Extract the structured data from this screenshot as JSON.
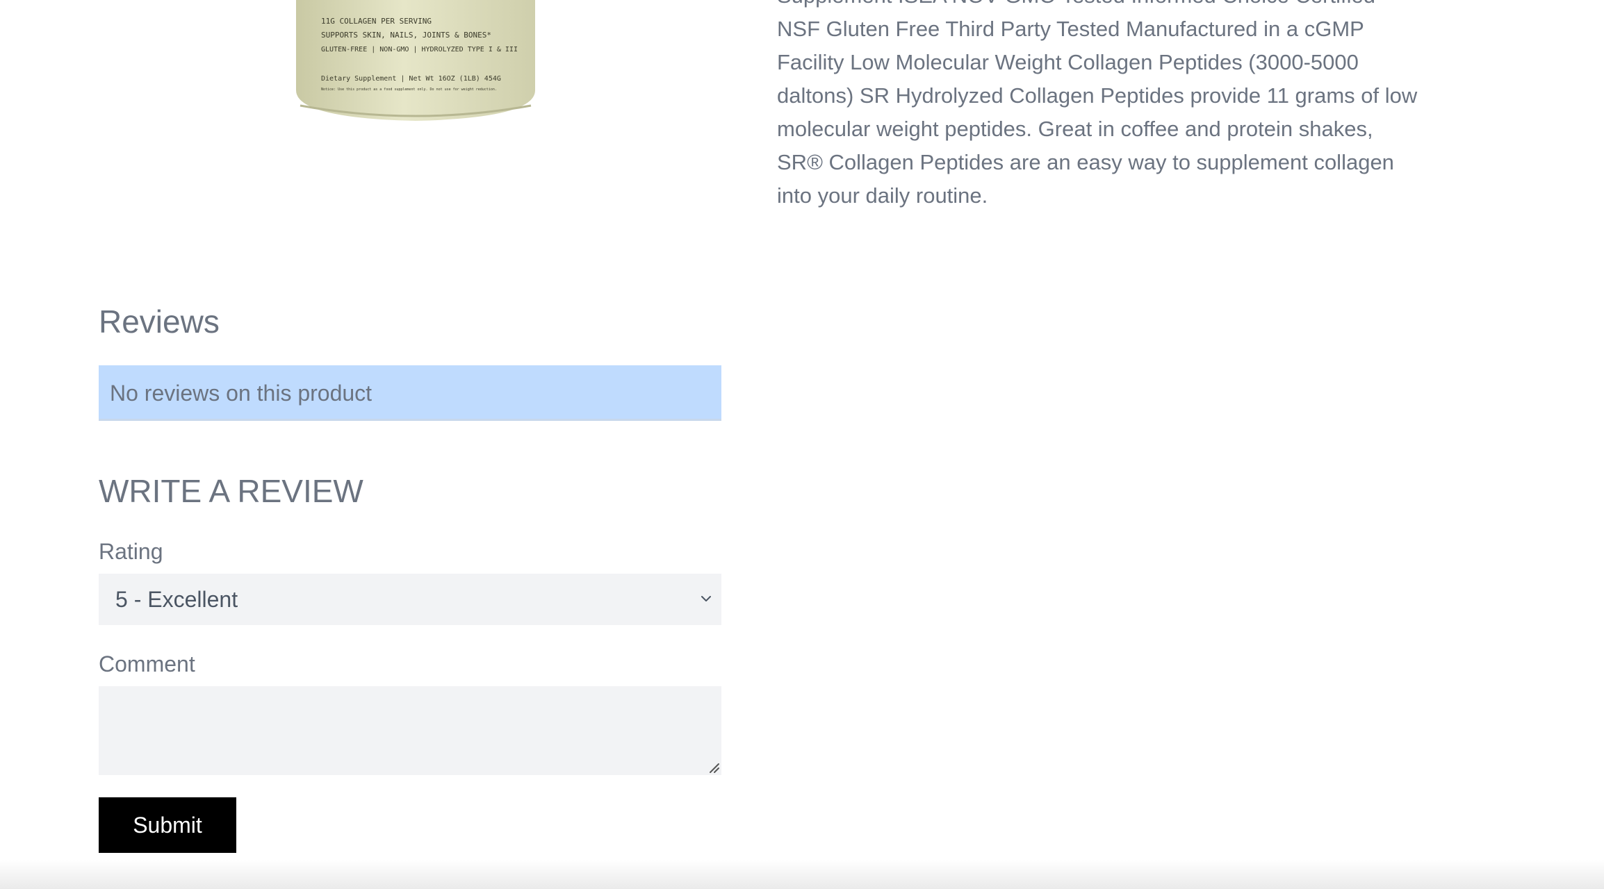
{
  "product": {
    "image_label_lines": [
      "11G COLLAGEN PER SERVING",
      "SUPPORTS SKIN, NAILS, JOINTS & BONES*",
      "GLUTEN-FREE | NON-GMO | HYDROLYZED TYPE I & III",
      "Dietary Supplement | Net Wt 16OZ (1LB) 454G",
      "Notice: Use this product as a food supplement only. Do not use for weight reduction."
    ],
    "description": "Supplement ISEA NOV GMO Tested Informed Choice Certified NSF Gluten Free Third Party Tested Manufactured in a cGMP Facility Low Molecular Weight Collagen Peptides (3000-5000 daltons) SR Hydrolyzed Collagen Peptides provide 11 grams of low molecular weight peptides. Great in coffee and protein shakes, SR® Collagen Peptides are an easy way to supplement collagen into your daily routine."
  },
  "reviews": {
    "heading": "Reviews",
    "empty_message": "No reviews on this product"
  },
  "write_review": {
    "heading": "WRITE A REVIEW",
    "rating_label": "Rating",
    "rating_selected": "5 - Excellent",
    "comment_label": "Comment",
    "comment_value": "",
    "submit_label": "Submit"
  },
  "colors": {
    "text": "#6b7380",
    "alert_bg": "#bfdbfe",
    "input_bg": "#f2f3f5",
    "button_bg": "#000000",
    "button_text": "#ffffff"
  },
  "icons": {
    "select_chevron": "chevron-down-icon",
    "textarea_grip": "resize-grip-icon"
  }
}
